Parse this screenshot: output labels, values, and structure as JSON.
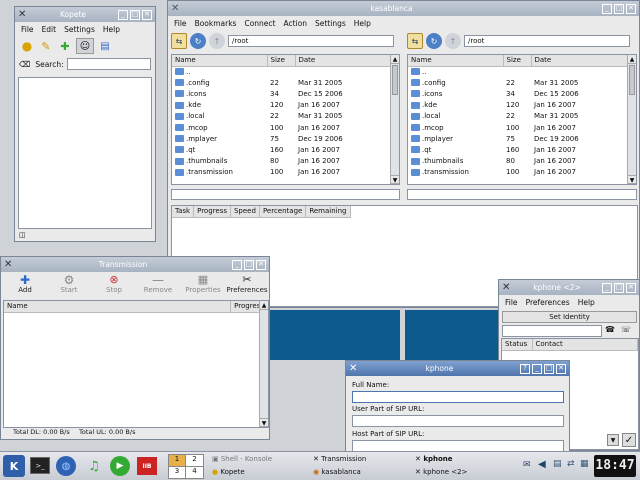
{
  "colors": {
    "accent": "#4e75ad",
    "inactive": "#a8b3c2",
    "desktop_blue": "#0e5a8c"
  },
  "kasablanca": {
    "title": "kasablanca",
    "menu": [
      "File",
      "Bookmarks",
      "Connect",
      "Action",
      "Settings",
      "Help"
    ],
    "left_path": "/root",
    "right_path": "/root",
    "columns": [
      "Name",
      "Size",
      "Date"
    ],
    "files": [
      {
        "name": "..",
        "size": "",
        "date": ""
      },
      {
        "name": ".config",
        "size": "22",
        "date": "Mar 31 2005"
      },
      {
        "name": ".icons",
        "size": "34",
        "date": "Dec 15 2006"
      },
      {
        "name": ".kde",
        "size": "120",
        "date": "Jan 16 2007"
      },
      {
        "name": ".local",
        "size": "22",
        "date": "Mar 31 2005"
      },
      {
        "name": ".mcop",
        "size": "100",
        "date": "Jan 16 2007"
      },
      {
        "name": ".mplayer",
        "size": "75",
        "date": "Dec 19 2006"
      },
      {
        "name": ".qt",
        "size": "160",
        "date": "Jan 16 2007"
      },
      {
        "name": ".thumbnails",
        "size": "80",
        "date": "Jan 16 2007"
      },
      {
        "name": ".transmission",
        "size": "100",
        "date": "Jan 16 2007"
      }
    ],
    "queue_columns": [
      "Task",
      "Progress",
      "Speed",
      "Percentage",
      "Remaining"
    ]
  },
  "kopete": {
    "title": "Kopete",
    "menu": [
      "File",
      "Edit",
      "Settings",
      "Help"
    ],
    "search_label": "Search:"
  },
  "transmission": {
    "title": "Transmission",
    "toolbar": [
      "Add",
      "Start",
      "Stop",
      "Remove",
      "Properties",
      "Preferences"
    ],
    "columns": [
      "Name",
      "Progress"
    ],
    "total_dl": "Total DL: 0.00 B/s",
    "total_ul": "Total UL: 0.00 B/s"
  },
  "kphone2": {
    "title": "kphone <2>",
    "menu": [
      "File",
      "Preferences",
      "Help"
    ],
    "set_identity": "Set Identity",
    "columns": [
      "Status",
      "Contact"
    ]
  },
  "kphone": {
    "title": "kphone",
    "full_name": "Full Name:",
    "user_part": "User Part of SIP URL:",
    "host_part": "Host Part of SIP URL:"
  },
  "taskbar": {
    "desktops": [
      "1",
      "2",
      "3",
      "4"
    ],
    "tasks": [
      {
        "label": "Shell - Konsole",
        "icon": "konsole-icon"
      },
      {
        "label": "Transmission",
        "icon": "transmission-icon"
      },
      {
        "label": "kphone",
        "icon": "kphone-icon",
        "bold": true
      },
      {
        "label": "Kopete",
        "icon": "kopete-icon"
      },
      {
        "label": "kasablanca",
        "icon": "kasablanca-icon"
      },
      {
        "label": "kphone <2>",
        "icon": "kphone-icon"
      }
    ],
    "clock": "18:47"
  }
}
